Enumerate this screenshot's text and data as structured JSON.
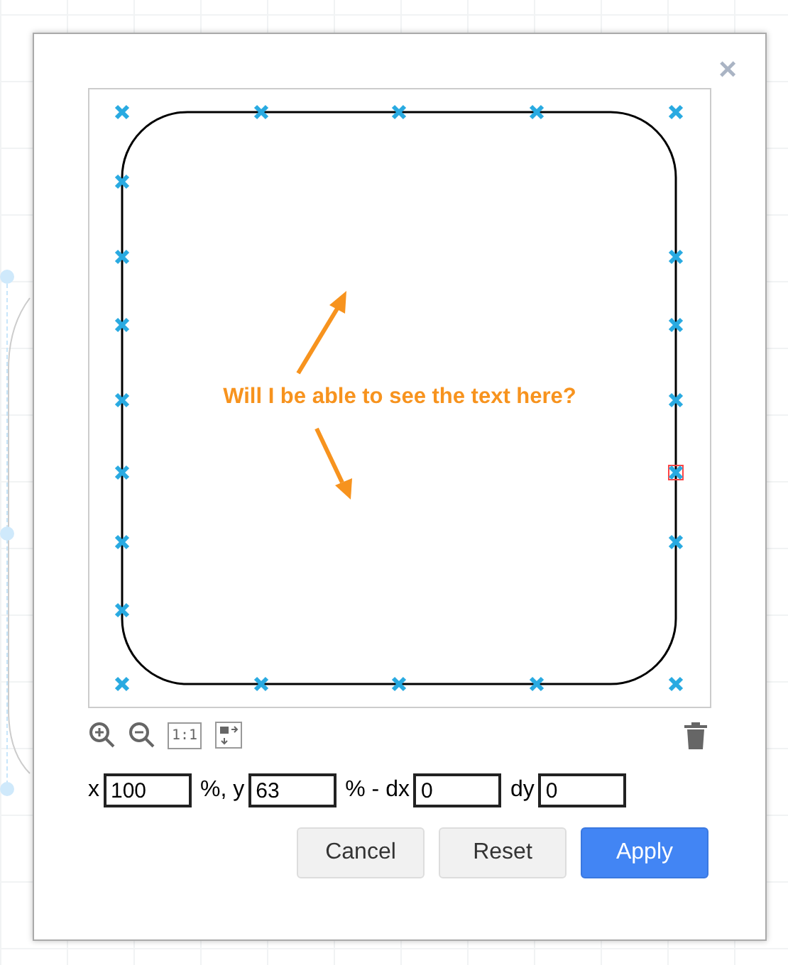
{
  "dialog": {
    "close": "×"
  },
  "preview": {
    "text": "Will I be able to see the text here?",
    "connection_points": [
      {
        "selected": false
      },
      {
        "selected": false
      },
      {
        "selected": false
      },
      {
        "selected": false
      },
      {
        "selected": false
      },
      {
        "selected": false
      },
      {
        "selected": false
      },
      {
        "selected": false
      },
      {
        "selected": false
      },
      {
        "selected": false
      },
      {
        "selected": false
      },
      {
        "selected": false
      },
      {
        "selected": false
      },
      {
        "selected": false
      },
      {
        "selected": false
      },
      {
        "selected": true
      },
      {
        "selected": false
      },
      {
        "selected": false
      },
      {
        "selected": false
      },
      {
        "selected": false
      },
      {
        "selected": false
      },
      {
        "selected": false
      }
    ]
  },
  "toolbar": {
    "actual_size": "1:1"
  },
  "fields": [
    {
      "label": "x",
      "value": "100"
    },
    {
      "label": "%, y",
      "value": "63"
    },
    {
      "label": "% - dx",
      "value": "0"
    },
    {
      "label": "dy",
      "value": "0"
    }
  ],
  "buttons": [
    {
      "label": "Cancel",
      "kind": "default"
    },
    {
      "label": "Reset",
      "kind": "default"
    },
    {
      "label": "Apply",
      "kind": "primary"
    }
  ]
}
